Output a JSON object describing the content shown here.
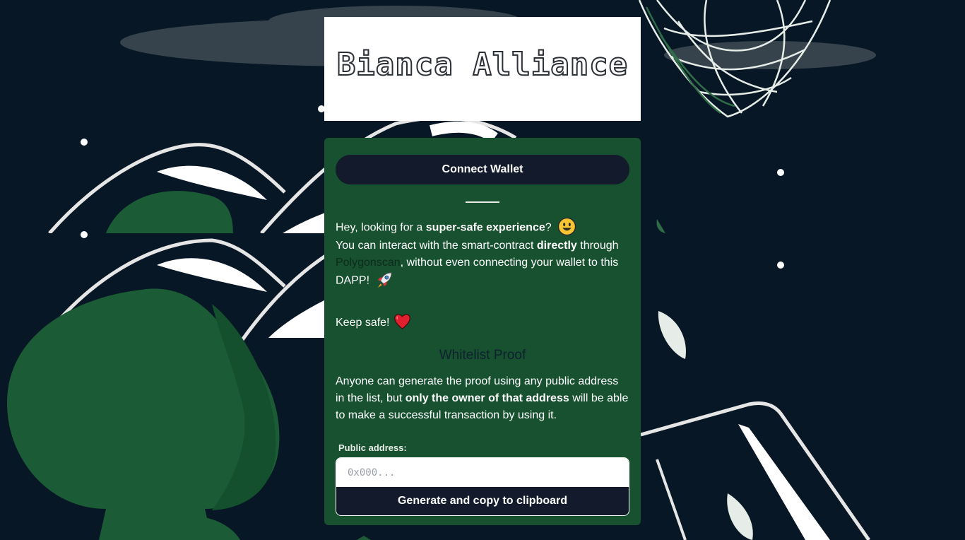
{
  "brand": {
    "logo_text": "Bianca Alliance"
  },
  "colors": {
    "background": "#081726",
    "panel": "#17512f",
    "button": "#121a2b",
    "tree": "#1b5b35"
  },
  "wallet": {
    "connect_label": "Connect Wallet"
  },
  "intro": {
    "line1_pre": "Hey, looking for a ",
    "line1_bold": "super-safe experience",
    "line1_post": "?",
    "emoji1": "smiley-emoji",
    "line2_pre": "You can interact with the smart-contract ",
    "line2_bold": "directly",
    "line2_post": " through ",
    "link_text": "Polygonscan",
    "line3_post": ", without even connecting your wallet to this DAPP!",
    "emoji2": "rocket-emoji",
    "keep_safe": "Keep safe!",
    "emoji3": "heart-emoji"
  },
  "whitelist": {
    "title": "Whitelist Proof",
    "para_pre": "Anyone can generate the proof using any public address in the list, but ",
    "para_bold": "only the owner of that address",
    "para_post": " will be able to make a successful transaction by using it.",
    "field_label": "Public address:",
    "placeholder": "0x000...",
    "generate_label": "Generate and copy to clipboard"
  }
}
